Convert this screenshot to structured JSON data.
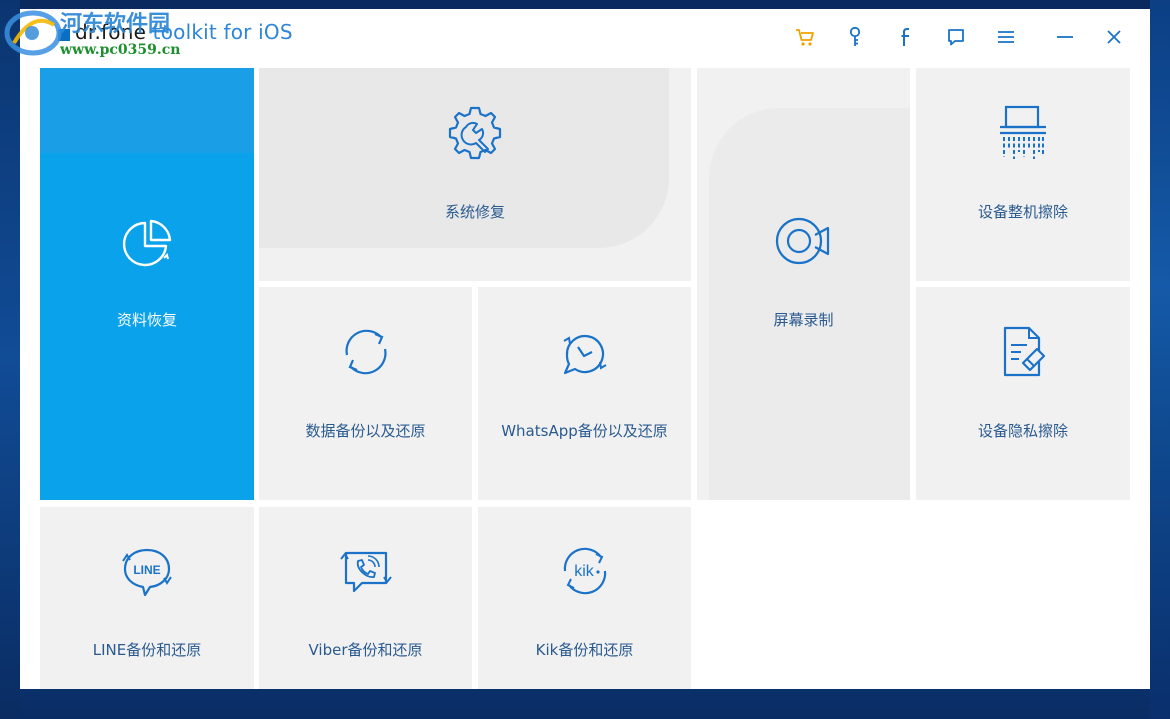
{
  "window": {
    "title_brand": "dr.fone",
    "title_rest": "toolkit for iOS"
  },
  "watermark": {
    "site_name": "河东软件园",
    "url": "www.pc0359.cn"
  },
  "toolbar": {
    "icons": [
      "cart-icon",
      "key-icon",
      "facebook-icon",
      "feedback-icon",
      "menu-icon",
      "minimize-icon",
      "close-icon"
    ],
    "accent_color": "#f0a000",
    "icon_color": "#1a73c8"
  },
  "tiles": {
    "data_recovery": "资料恢复",
    "system_repair": "系统修复",
    "screen_recorder": "屏幕录制",
    "full_erase": "设备整机擦除",
    "data_backup_restore": "数据备份以及还原",
    "whatsapp_backup": "WhatsApp备份以及还原",
    "privacy_erase": "设备隐私擦除",
    "line_backup": "LINE备份和还原",
    "viber_backup": "Viber备份和还原",
    "kik_backup": "Kik备份和还原"
  },
  "icon_text": {
    "line": "LINE",
    "kik": "kik"
  },
  "colors": {
    "primary_blue": "#0aa2ea",
    "tile_bg": "#f1f1f1",
    "icon_blue": "#1a73c8",
    "label_blue": "#2a5a90"
  }
}
